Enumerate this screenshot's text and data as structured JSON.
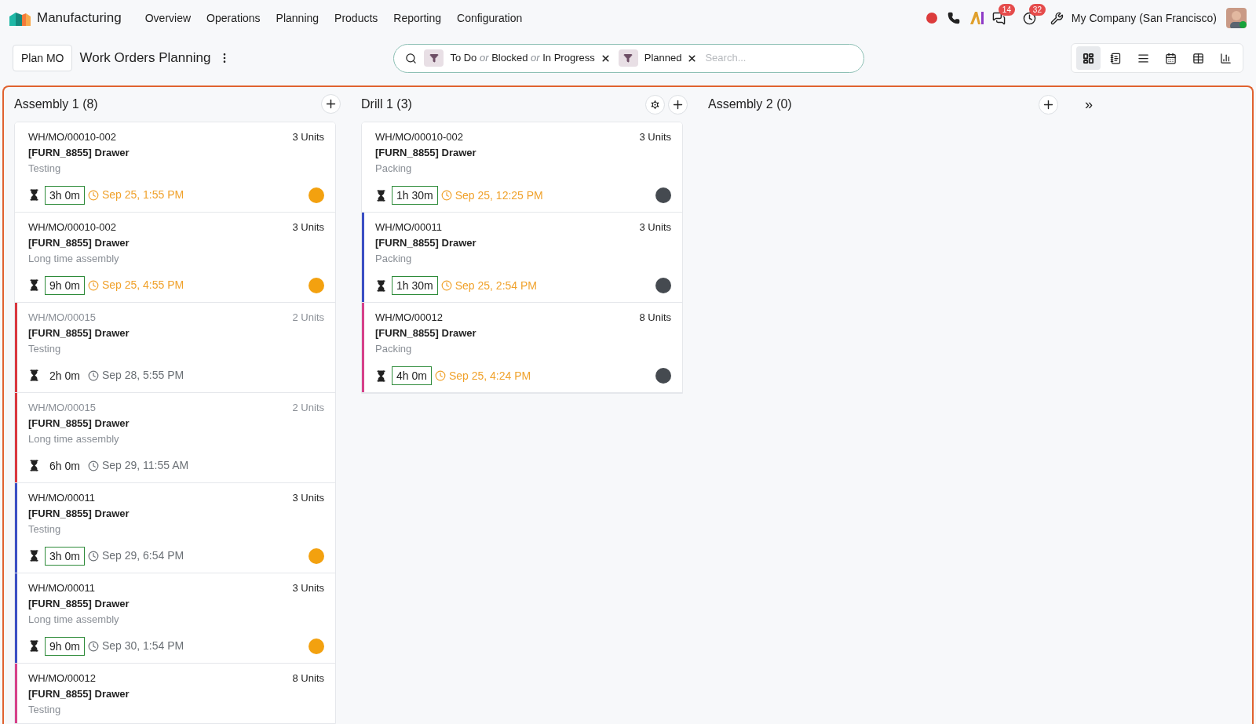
{
  "app": {
    "name": "Manufacturing"
  },
  "menu": [
    "Overview",
    "Operations",
    "Planning",
    "Products",
    "Reporting",
    "Configuration"
  ],
  "systray": {
    "recording": true,
    "messages_badge": "14",
    "activities_badge": "32",
    "company": "My Company (San Francisco)",
    "user_online": true
  },
  "control_panel": {
    "primary_button": "Plan MO",
    "title": "Work Orders Planning"
  },
  "search": {
    "facets": [
      {
        "tokens": [
          {
            "kind": "value",
            "text": "To Do"
          },
          {
            "kind": "separator",
            "text": "or"
          },
          {
            "kind": "value",
            "text": "Blocked"
          },
          {
            "kind": "separator",
            "text": "or"
          },
          {
            "kind": "value",
            "text": "In Progress"
          }
        ]
      },
      {
        "tokens": [
          {
            "kind": "value",
            "text": "Planned"
          }
        ]
      }
    ],
    "placeholder": "Search..."
  },
  "view_switcher": [
    {
      "kind": "kanban",
      "selected": true
    },
    {
      "kind": "form",
      "selected": false
    },
    {
      "kind": "list",
      "selected": false
    },
    {
      "kind": "calendar",
      "selected": false
    },
    {
      "kind": "pivot",
      "selected": false
    },
    {
      "kind": "graph",
      "selected": false
    }
  ],
  "columns": [
    {
      "title": "Assembly 1 (8)",
      "settings": false,
      "cards": [
        {
          "ref": "WH/MO/00010-002",
          "qty": "3 Units",
          "product": "[FURN_8855] Drawer",
          "operation": "Testing",
          "duration": "3h 0m",
          "boxed": true,
          "date": "Sep 25, 1:55 PM",
          "late": true,
          "muted": false,
          "status": {
            "color": "#f3a10f"
          }
        },
        {
          "ref": "WH/MO/00010-002",
          "qty": "3 Units",
          "product": "[FURN_8855] Drawer",
          "operation": "Long time assembly",
          "duration": "9h 0m",
          "boxed": true,
          "date": "Sep 25, 4:55 PM",
          "late": true,
          "muted": false,
          "status": {
            "color": "#f3a10f"
          }
        },
        {
          "ref": "WH/MO/00015",
          "qty": "2 Units",
          "product": "[FURN_8855] Drawer",
          "operation": "Testing",
          "duration": "2h 0m",
          "boxed": false,
          "date": "Sep 28, 5:55 PM",
          "late": false,
          "muted": true,
          "color": "#d9363e"
        },
        {
          "ref": "WH/MO/00015",
          "qty": "2 Units",
          "product": "[FURN_8855] Drawer",
          "operation": "Long time assembly",
          "duration": "6h 0m",
          "boxed": false,
          "date": "Sep 29, 11:55 AM",
          "late": false,
          "muted": true,
          "color": "#d9363e"
        },
        {
          "ref": "WH/MO/00011",
          "qty": "3 Units",
          "product": "[FURN_8855] Drawer",
          "operation": "Testing",
          "duration": "3h 0m",
          "boxed": true,
          "date": "Sep 29, 6:54 PM",
          "late": false,
          "muted": false,
          "status": {
            "color": "#f3a10f"
          },
          "color": "#3b4fc4"
        },
        {
          "ref": "WH/MO/00011",
          "qty": "3 Units",
          "product": "[FURN_8855] Drawer",
          "operation": "Long time assembly",
          "duration": "9h 0m",
          "boxed": true,
          "date": "Sep 30, 1:54 PM",
          "late": false,
          "muted": false,
          "status": {
            "color": "#f3a10f"
          },
          "color": "#3b4fc4"
        },
        {
          "ref": "WH/MO/00012",
          "qty": "8 Units",
          "product": "[FURN_8855] Drawer",
          "operation": "Testing",
          "muted": false,
          "color": "#d6418a"
        }
      ]
    },
    {
      "title": "Drill 1 (3)",
      "settings": true,
      "cards": [
        {
          "ref": "WH/MO/00010-002",
          "qty": "3 Units",
          "product": "[FURN_8855] Drawer",
          "operation": "Packing",
          "duration": "1h 30m",
          "boxed": true,
          "date": "Sep 25, 12:25 PM",
          "late": true,
          "muted": false,
          "status": {
            "color": "#454a50"
          }
        },
        {
          "ref": "WH/MO/00011",
          "qty": "3 Units",
          "product": "[FURN_8855] Drawer",
          "operation": "Packing",
          "duration": "1h 30m",
          "boxed": true,
          "date": "Sep 25, 2:54 PM",
          "late": true,
          "muted": false,
          "status": {
            "color": "#454a50"
          },
          "color": "#3b4fc4"
        },
        {
          "ref": "WH/MO/00012",
          "qty": "8 Units",
          "product": "[FURN_8855] Drawer",
          "operation": "Packing",
          "duration": "4h 0m",
          "boxed": true,
          "date": "Sep 25, 4:24 PM",
          "late": true,
          "muted": false,
          "status": {
            "color": "#454a50"
          },
          "color": "#d6418a"
        }
      ]
    },
    {
      "title": "Assembly 2 (0)",
      "settings": false
    }
  ],
  "fold_button": "»"
}
